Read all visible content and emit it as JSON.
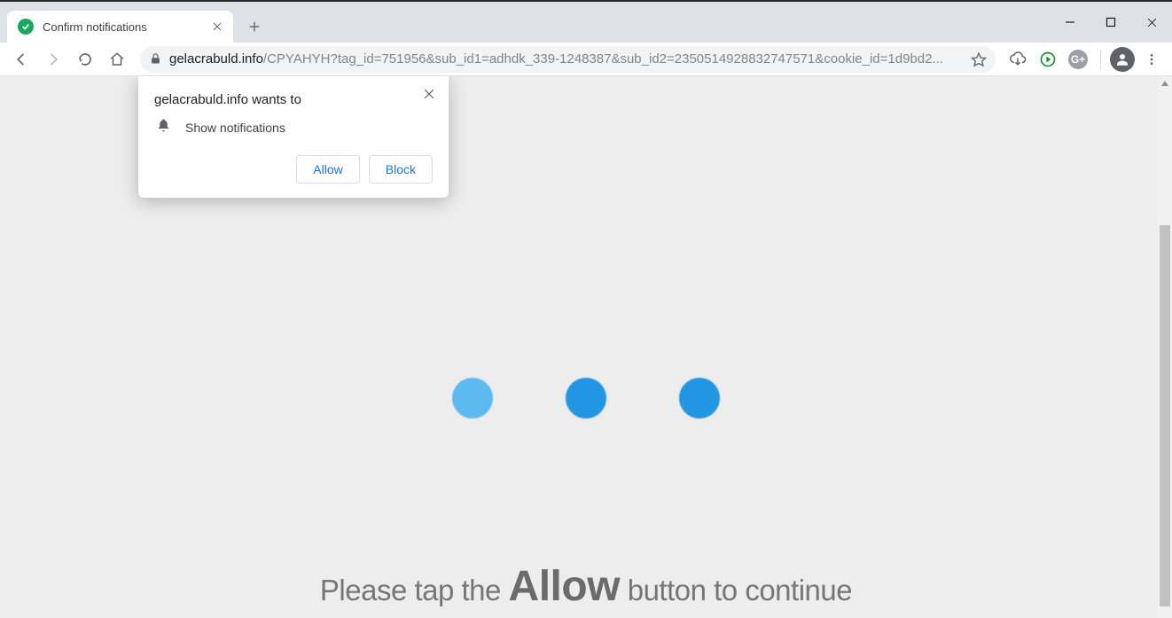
{
  "tab": {
    "title": "Confirm notifications"
  },
  "url": {
    "host": "gelacrabuld.info",
    "path": "/CPYAHYH?tag_id=751956&sub_id1=adhdk_339-1248387&sub_id2=2350514928832747571&cookie_id=1d9bd2..."
  },
  "permission": {
    "title": "gelacrabuld.info wants to",
    "item": "Show notifications",
    "allow": "Allow",
    "block": "Block"
  },
  "page": {
    "msg_pre": "Please tap the ",
    "msg_big": "Allow",
    "msg_post": " button to continue"
  }
}
